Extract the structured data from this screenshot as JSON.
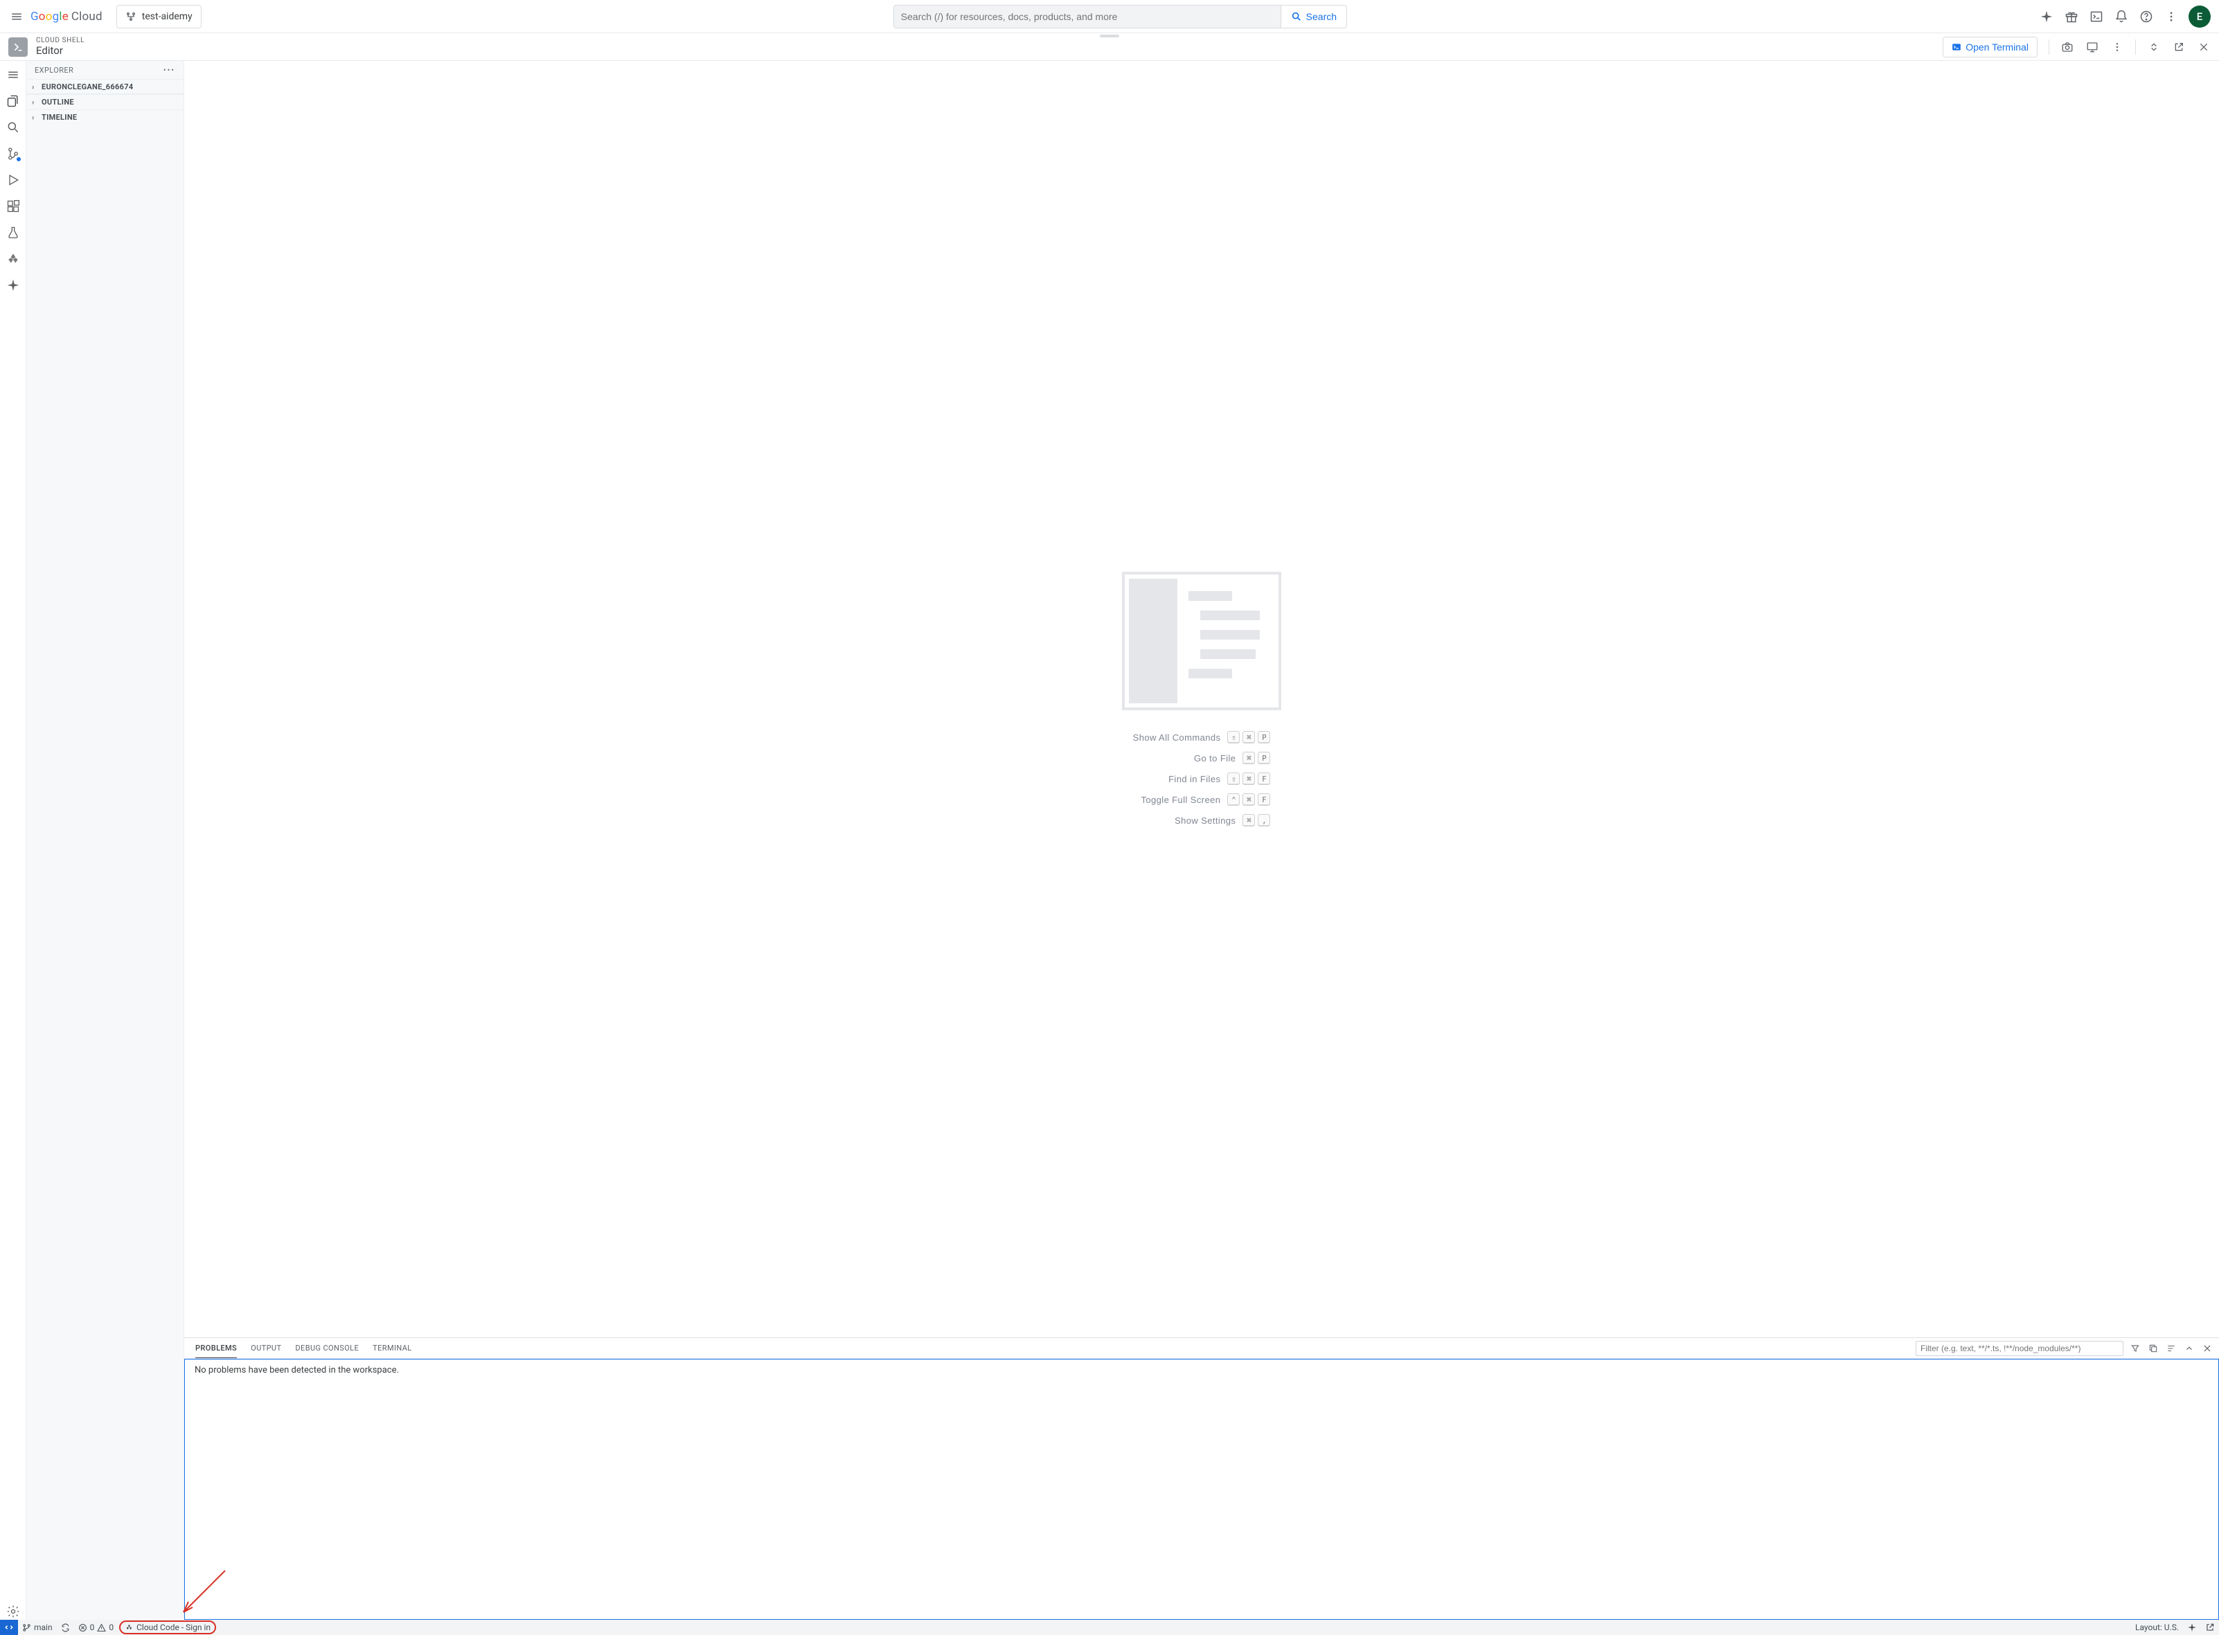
{
  "header": {
    "logo_cloud": "Cloud",
    "project_label": "test-aidemy",
    "search_placeholder": "Search (/) for resources, docs, products, and more",
    "search_button": "Search",
    "avatar_initial": "E"
  },
  "shell": {
    "eyebrow": "CLOUD SHELL",
    "title": "Editor",
    "open_terminal": "Open Terminal"
  },
  "explorer": {
    "title": "EXPLORER",
    "rows": [
      "EURONCLEGANE_666674",
      "OUTLINE",
      "TIMELINE"
    ]
  },
  "welcome": {
    "cmds": [
      {
        "label": "Show All Commands",
        "keys": [
          "⇧",
          "⌘",
          "P"
        ]
      },
      {
        "label": "Go to File",
        "keys": [
          "⌘",
          "P"
        ]
      },
      {
        "label": "Find in Files",
        "keys": [
          "⇧",
          "⌘",
          "F"
        ]
      },
      {
        "label": "Toggle Full Screen",
        "keys": [
          "⌃",
          "⌘",
          "F"
        ]
      },
      {
        "label": "Show Settings",
        "keys": [
          "⌘",
          ","
        ]
      }
    ]
  },
  "panel": {
    "tabs": [
      "PROBLEMS",
      "OUTPUT",
      "DEBUG CONSOLE",
      "TERMINAL"
    ],
    "active_tab": "PROBLEMS",
    "filter_placeholder": "Filter (e.g. text, **/*.ts, !**/node_modules/**)",
    "body": "No problems have been detected in the workspace."
  },
  "statusbar": {
    "branch": "main",
    "errors": "0",
    "warnings": "0",
    "cloud_code": "Cloud Code - Sign in",
    "layout": "Layout: U.S."
  }
}
